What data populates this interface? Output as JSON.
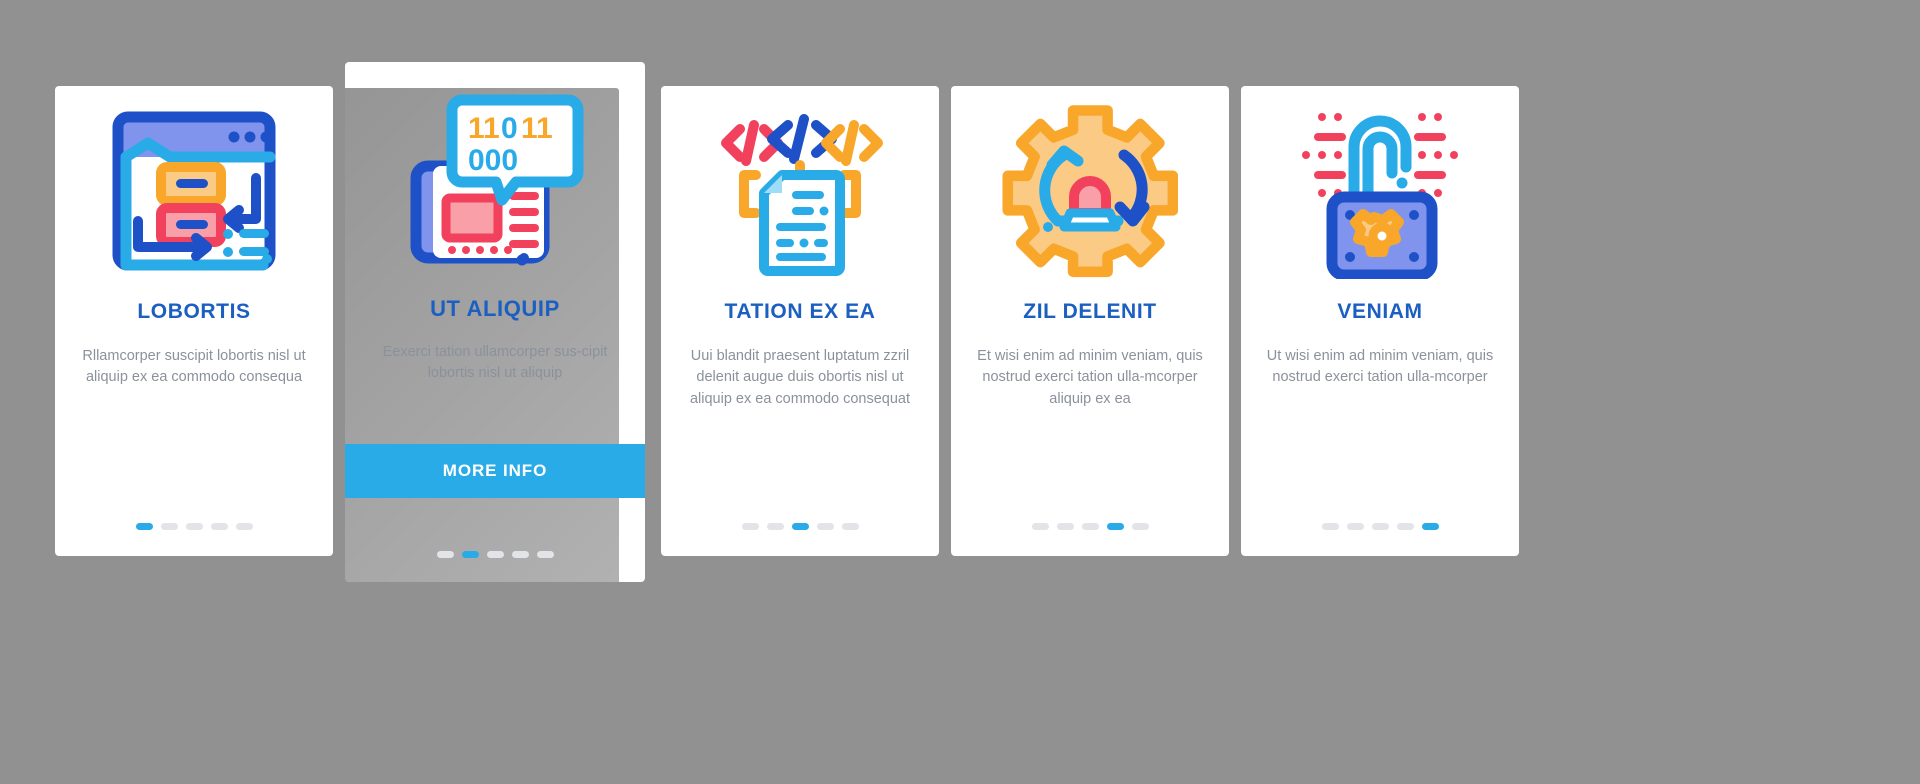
{
  "background_color": "#919191",
  "palette": {
    "title_blue": "#1b5fc1",
    "body_gray": "#8b919b",
    "accent_cyan": "#29abe8",
    "dot_inactive": "#e2e4e7",
    "deep_blue": "#1e50c8",
    "light_blue": "#29abe8",
    "periwinkle": "#8094ee",
    "orange": "#f9a72b",
    "light_orange": "#fbcb86",
    "red": "#f2415c",
    "light_red": "#f99fa8",
    "card_white": "#ffffff"
  },
  "cards": [
    {
      "id": "lobortis",
      "icon_name": "browser-workflow-icon",
      "title": "LOBORTIS",
      "body": "Rllamcorper suscipit lobortis nisl ut aliquip ex ea commodo consequa",
      "featured": false,
      "dots_total": 5,
      "dot_active_index": 0
    },
    {
      "id": "ut-aliquip",
      "icon_name": "binary-chat-device-icon",
      "title": "UT ALIQUIP",
      "body": "Eexerci tation ullamcorper sus-cipit lobortis nisl ut aliquip",
      "featured": true,
      "button_label": "MORE INFO",
      "dots_total": 5,
      "dot_active_index": 1
    },
    {
      "id": "tation-ex-ea",
      "icon_name": "code-document-icon",
      "title": "TATION EX EA",
      "body": "Uui blandit praesent luptatum zzril delenit augue duis obortis nisl ut aliquip ex ea commodo consequat",
      "featured": false,
      "dots_total": 5,
      "dot_active_index": 2
    },
    {
      "id": "zil-delenit",
      "icon_name": "gear-alarm-refresh-icon",
      "title": "ZIL DELENIT",
      "body": "Et wisi enim ad minim veniam, quis nostrud exerci tation ulla-mcorper aliquip ex ea",
      "featured": false,
      "dots_total": 5,
      "dot_active_index": 3
    },
    {
      "id": "veniam",
      "icon_name": "padlock-gear-icon",
      "title": "VENIAM",
      "body": "Ut wisi enim ad minim veniam, quis nostrud exerci tation ulla-mcorper",
      "featured": false,
      "dots_total": 5,
      "dot_active_index": 4
    }
  ]
}
